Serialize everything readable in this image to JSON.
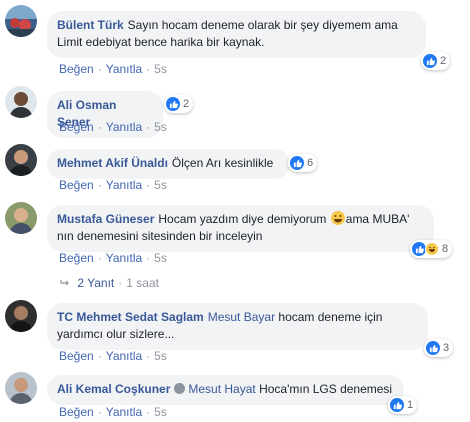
{
  "comments": [
    {
      "author": "Bülent Türk",
      "text": "Sayın hocam deneme olarak bir şey diyemem ama Limit edebiyat bence harika bir kaynak.",
      "reactions": "2",
      "like": "Beğen",
      "reply": "Yanıtla",
      "time": "5s"
    },
    {
      "author": "Ali Osman Şener",
      "text": "",
      "reactions": "2",
      "like": "Beğen",
      "reply": "Yanıtla",
      "time": "5s"
    },
    {
      "author": "Mehmet Akif Ünaldı",
      "text": "Ölçen Arı kesinlikle",
      "reactions": "6",
      "like": "Beğen",
      "reply": "Yanıtla",
      "time": "5s"
    },
    {
      "author": "Mustafa Güneser",
      "text_a": "Hocam yazdım diye demiyorum",
      "text_b": "ama MUBA' nın denemesini sitesinden bir inceleyin",
      "reactions": "8",
      "like": "Beğen",
      "reply": "Yanıtla",
      "time": "5s",
      "replies_label": "2 Yanıt",
      "replies_time": "1 saat"
    },
    {
      "author": "TC Mehmet Sedat Saglam",
      "mention": "Mesut Bayar",
      "text": "hocam deneme için yardımcı olur sizlere...",
      "reactions": "3",
      "like": "Beğen",
      "reply": "Yanıtla",
      "time": "5s"
    },
    {
      "author": "Ali Kemal Coşkuner",
      "mention": "Mesut Hayat",
      "text": "Hoca'mın LGS denemesi",
      "reactions": "1",
      "like": "Beğen",
      "reply": "Yanıtla",
      "time": "5s"
    }
  ],
  "colors": {
    "link": "#385898",
    "bubble": "#f2f3f5",
    "like_blue": "#2078f4",
    "meta_gray": "#90949c"
  }
}
